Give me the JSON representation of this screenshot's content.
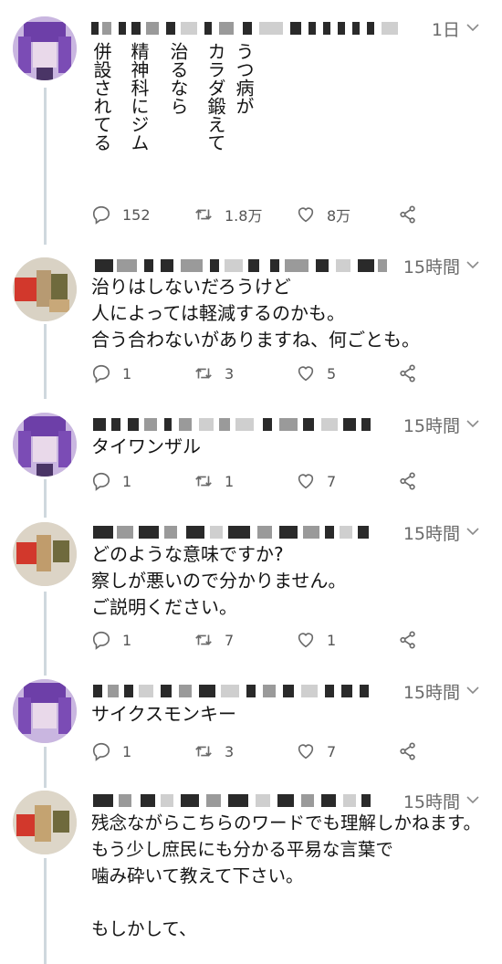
{
  "tweets": [
    {
      "time": "1日",
      "vertical_columns": [
        "うつ病が",
        "カラダ鍛えて",
        "治るなら",
        "精神科にジム",
        "併設されてる"
      ],
      "replies": "152",
      "retweets": "1.8万",
      "likes": "8万",
      "avatar": "purple-hair"
    },
    {
      "time": "15時間",
      "text": "治りはしないだろうけど\n人によっては軽減するのかも。\n合う合わないがありますね、何ごとも。",
      "replies": "1",
      "retweets": "3",
      "likes": "5",
      "avatar": "tan-red"
    },
    {
      "time": "15時間",
      "text": "タイワンザル",
      "replies": "1",
      "retweets": "1",
      "likes": "7",
      "avatar": "purple-hair"
    },
    {
      "time": "15時間",
      "text": "どのような意味ですか?\n察しが悪いので分かりません。\nご説明ください。",
      "replies": "1",
      "retweets": "7",
      "likes": "1",
      "avatar": "tan-red"
    },
    {
      "time": "15時間",
      "text": "サイクスモンキー",
      "replies": "1",
      "retweets": "3",
      "likes": "7",
      "avatar": "purple-hair"
    },
    {
      "time": "15時間",
      "text": "残念ながらこちらのワードでも理解しかねます。\nもう少し庶民にも分かる平易な言葉で\n噛み砕いて教えて下さい。\n\nもしかして、",
      "avatar": "tan-red"
    }
  ]
}
